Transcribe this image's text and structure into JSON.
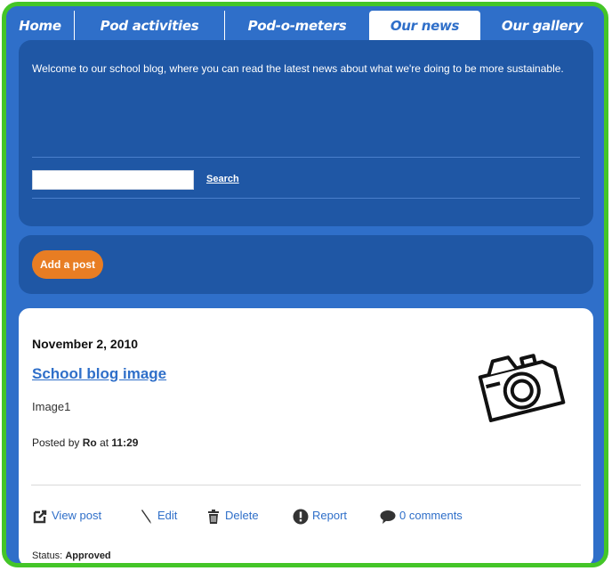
{
  "nav": {
    "tabs": [
      {
        "label": "Home",
        "active": false
      },
      {
        "label": "Pod activities",
        "active": false
      },
      {
        "label": "Pod-o-meters",
        "active": false
      },
      {
        "label": "Our news",
        "active": true
      },
      {
        "label": "Our gallery",
        "active": false
      }
    ]
  },
  "intro": {
    "text": "Welcome to our school blog, where you can read the latest news about what we're doing to be more sustainable.",
    "search_link": "Search",
    "search_value": ""
  },
  "actions": {
    "add_post": "Add a post"
  },
  "post": {
    "date": "November 2, 2010",
    "title": "School blog image",
    "caption": "Image1",
    "posted_by_label": "Posted by",
    "author": "Ro",
    "at_label": "at",
    "time": "11:29",
    "links": {
      "view": "View post",
      "edit": "Edit",
      "delete": "Delete",
      "report": "Report",
      "comments": "0 comments"
    },
    "status_label": "Status:",
    "status_value": "Approved"
  },
  "colors": {
    "frame": "#44c528",
    "nav": "#2f6fc9",
    "panel": "#1f57a5",
    "add_button": "#e87d23",
    "link": "#2f6fc9"
  },
  "icons": [
    "camera-icon",
    "external-link-icon",
    "pencil-icon",
    "trash-icon",
    "alert-icon",
    "comment-icon"
  ]
}
